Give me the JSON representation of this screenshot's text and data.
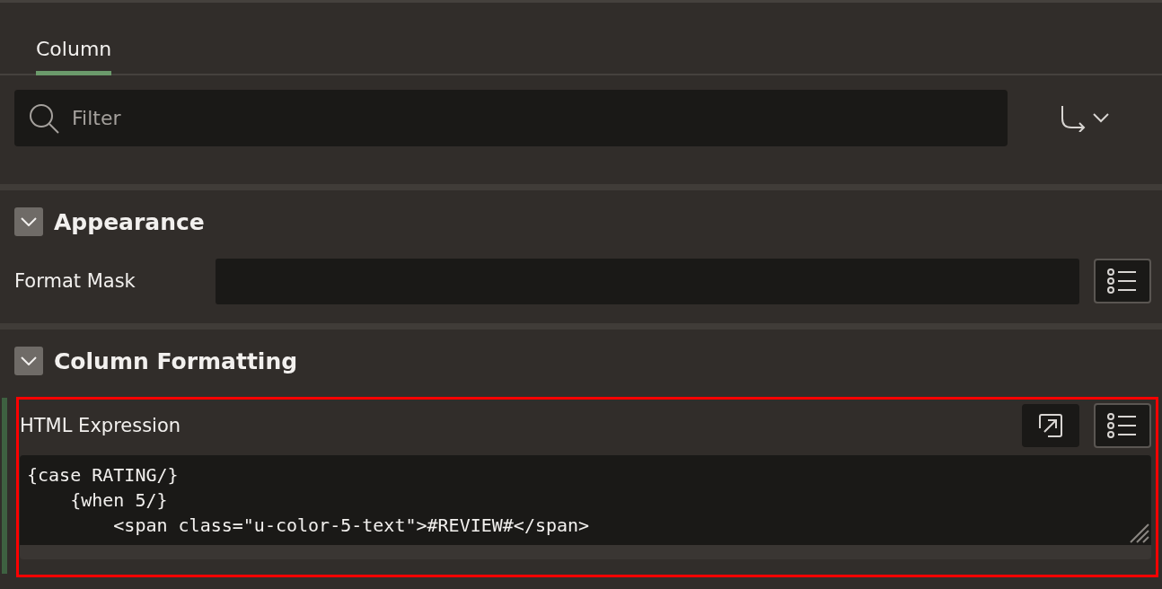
{
  "tabs": [
    {
      "label": "Column",
      "selected": true
    }
  ],
  "filter": {
    "placeholder": "Filter"
  },
  "sections": [
    {
      "title": "Appearance",
      "expanded": true,
      "properties": [
        {
          "kind": "text",
          "label": "Format Mask"
        }
      ]
    },
    {
      "title": "Column Formatting",
      "expanded": true,
      "properties": [
        {
          "kind": "code",
          "label": "HTML Expression",
          "highlighted": true,
          "lines": [
            "{case RATING/}",
            "    {when 5/}",
            "        <span class=\"u-color-5-text\">#REVIEW#</span>"
          ]
        }
      ]
    }
  ]
}
